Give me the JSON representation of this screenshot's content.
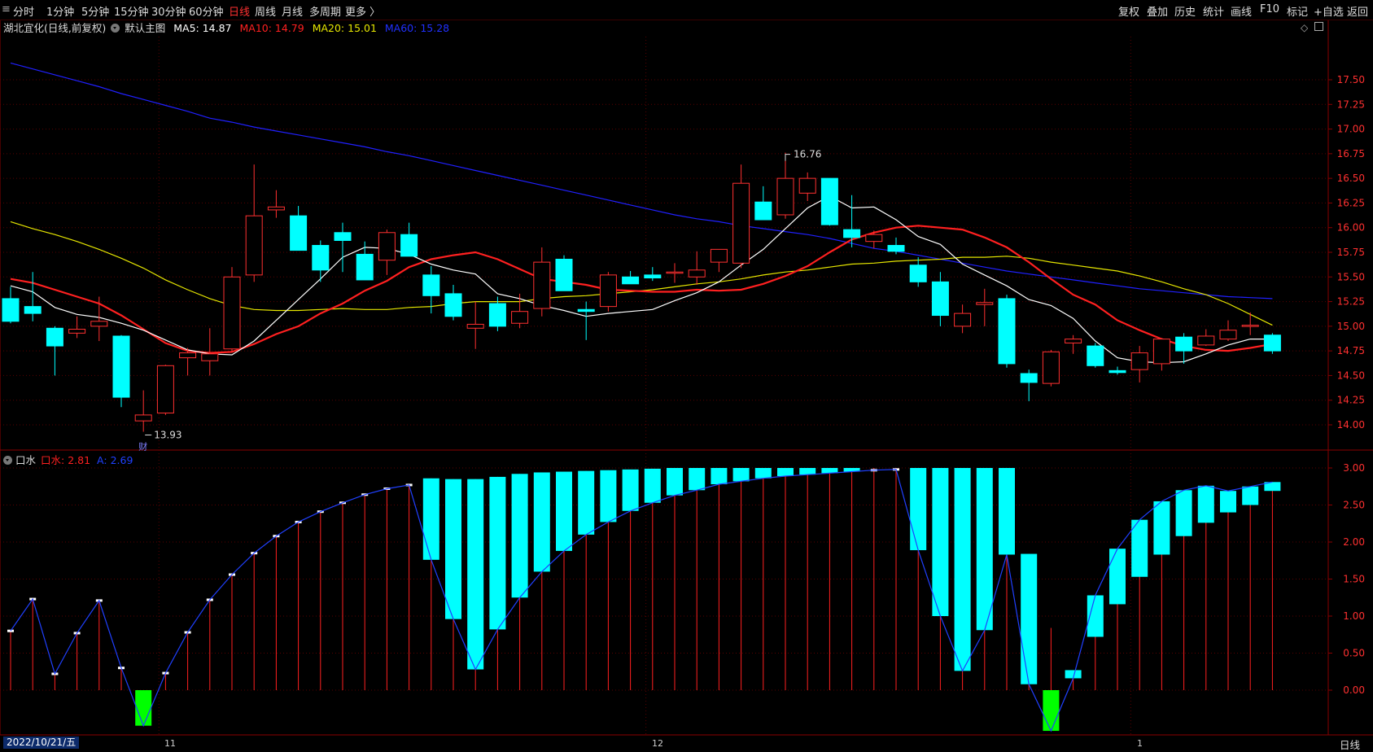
{
  "toolbar": {
    "menu_icon": "≡",
    "periods": [
      "分时",
      "1分钟",
      "5分钟",
      "15分钟",
      "30分钟",
      "60分钟",
      "日线",
      "周线",
      "月线",
      "多周期",
      "更多 〉"
    ],
    "active_period": "日线",
    "right_items": [
      "复权",
      "叠加",
      "历史",
      "统计",
      "画线",
      "F10",
      "标记",
      "+自选",
      "返回"
    ]
  },
  "info": {
    "stock": "湖北宜化(日线,前复权)",
    "main_chart": "默认主图",
    "ma5": "MA5: 14.87",
    "ma10": "MA10: 14.79",
    "ma20": "MA20: 15.01",
    "ma60": "MA60: 15.28",
    "high_label": "16.76",
    "low_label": "13.93",
    "cai_label": "财"
  },
  "indicator": {
    "name": "口水",
    "value1": "口水: 2.81",
    "value2": "A: 2.69"
  },
  "bottom": {
    "date": "2022/10/21/五",
    "period": "日线",
    "months": [
      "11",
      "12",
      "1"
    ]
  },
  "colors": {
    "up": "#ff3030",
    "down": "#00ffff",
    "ma5": "#ffffff",
    "ma10": "#ff2020",
    "ma20": "#e6e600",
    "ma60": "#2020ff",
    "grid": "#5a0000",
    "indicator_line": "#2040ff",
    "neg_bar": "#00ff00"
  },
  "chart_data": [
    {
      "type": "candlestick",
      "title": "湖北宜化(日线,前复权)",
      "ylim": [
        13.8,
        17.8
      ],
      "y_ticks": [
        14.0,
        14.25,
        14.5,
        14.75,
        15.0,
        15.25,
        15.5,
        15.75,
        16.0,
        16.25,
        16.5,
        16.75,
        17.0,
        17.25,
        17.5
      ],
      "candles": [
        {
          "o": 15.28,
          "h": 15.4,
          "l": 15.03,
          "c": 15.05
        },
        {
          "o": 15.2,
          "h": 15.55,
          "l": 15.05,
          "c": 15.13
        },
        {
          "o": 14.98,
          "h": 15.0,
          "l": 14.5,
          "c": 14.8
        },
        {
          "o": 14.93,
          "h": 15.1,
          "l": 14.88,
          "c": 14.97
        },
        {
          "o": 15.0,
          "h": 15.3,
          "l": 14.85,
          "c": 15.05
        },
        {
          "o": 14.9,
          "h": 14.91,
          "l": 14.18,
          "c": 14.28
        },
        {
          "o": 14.04,
          "h": 14.35,
          "l": 13.93,
          "c": 14.1
        },
        {
          "o": 14.12,
          "h": 14.61,
          "l": 14.1,
          "c": 14.6
        },
        {
          "o": 14.68,
          "h": 14.78,
          "l": 14.5,
          "c": 14.73
        },
        {
          "o": 14.65,
          "h": 14.98,
          "l": 14.5,
          "c": 14.72
        },
        {
          "o": 14.77,
          "h": 15.6,
          "l": 14.74,
          "c": 15.5
        },
        {
          "o": 15.52,
          "h": 16.64,
          "l": 15.45,
          "c": 16.12
        },
        {
          "o": 16.18,
          "h": 16.38,
          "l": 16.1,
          "c": 16.21
        },
        {
          "o": 16.12,
          "h": 16.22,
          "l": 15.78,
          "c": 15.77
        },
        {
          "o": 15.82,
          "h": 15.87,
          "l": 15.45,
          "c": 15.57
        },
        {
          "o": 15.95,
          "h": 16.05,
          "l": 15.55,
          "c": 15.87
        },
        {
          "o": 15.73,
          "h": 15.86,
          "l": 15.47,
          "c": 15.47
        },
        {
          "o": 15.67,
          "h": 15.98,
          "l": 15.52,
          "c": 15.95
        },
        {
          "o": 15.93,
          "h": 16.05,
          "l": 15.73,
          "c": 15.71
        },
        {
          "o": 15.52,
          "h": 15.61,
          "l": 15.13,
          "c": 15.31
        },
        {
          "o": 15.33,
          "h": 15.42,
          "l": 15.06,
          "c": 15.1
        },
        {
          "o": 14.98,
          "h": 15.25,
          "l": 14.77,
          "c": 15.02
        },
        {
          "o": 15.23,
          "h": 15.3,
          "l": 14.95,
          "c": 15.0
        },
        {
          "o": 15.03,
          "h": 15.33,
          "l": 14.98,
          "c": 15.15
        },
        {
          "o": 15.18,
          "h": 15.8,
          "l": 15.1,
          "c": 15.65
        },
        {
          "o": 15.68,
          "h": 15.72,
          "l": 15.4,
          "c": 15.36
        },
        {
          "o": 15.17,
          "h": 15.25,
          "l": 14.86,
          "c": 15.15
        },
        {
          "o": 15.2,
          "h": 15.55,
          "l": 15.15,
          "c": 15.52
        },
        {
          "o": 15.5,
          "h": 15.56,
          "l": 15.44,
          "c": 15.43
        },
        {
          "o": 15.52,
          "h": 15.6,
          "l": 15.46,
          "c": 15.49
        },
        {
          "o": 15.55,
          "h": 15.64,
          "l": 15.44,
          "c": 15.55
        },
        {
          "o": 15.5,
          "h": 15.76,
          "l": 15.42,
          "c": 15.57
        },
        {
          "o": 15.65,
          "h": 15.78,
          "l": 15.55,
          "c": 15.78
        },
        {
          "o": 15.64,
          "h": 16.64,
          "l": 15.59,
          "c": 16.45
        },
        {
          "o": 16.26,
          "h": 16.42,
          "l": 16.1,
          "c": 16.08
        },
        {
          "o": 16.13,
          "h": 16.76,
          "l": 16.09,
          "c": 16.5
        },
        {
          "o": 16.35,
          "h": 16.56,
          "l": 16.27,
          "c": 16.5
        },
        {
          "o": 16.5,
          "h": 16.5,
          "l": 16.02,
          "c": 16.03
        },
        {
          "o": 15.98,
          "h": 16.33,
          "l": 15.8,
          "c": 15.9
        },
        {
          "o": 15.86,
          "h": 15.97,
          "l": 15.79,
          "c": 15.93
        },
        {
          "o": 15.82,
          "h": 15.9,
          "l": 15.73,
          "c": 15.76
        },
        {
          "o": 15.62,
          "h": 15.7,
          "l": 15.4,
          "c": 15.45
        },
        {
          "o": 15.45,
          "h": 15.55,
          "l": 15.0,
          "c": 15.11
        },
        {
          "o": 15.0,
          "h": 15.22,
          "l": 14.93,
          "c": 15.13
        },
        {
          "o": 15.22,
          "h": 15.38,
          "l": 15.0,
          "c": 15.24
        },
        {
          "o": 15.28,
          "h": 15.32,
          "l": 14.58,
          "c": 14.62
        },
        {
          "o": 14.52,
          "h": 14.56,
          "l": 14.24,
          "c": 14.43
        },
        {
          "o": 14.42,
          "h": 14.76,
          "l": 14.39,
          "c": 14.74
        },
        {
          "o": 14.83,
          "h": 14.91,
          "l": 14.72,
          "c": 14.87
        },
        {
          "o": 14.8,
          "h": 14.83,
          "l": 14.58,
          "c": 14.6
        },
        {
          "o": 14.55,
          "h": 14.59,
          "l": 14.51,
          "c": 14.53
        },
        {
          "o": 14.56,
          "h": 14.8,
          "l": 14.43,
          "c": 14.73
        },
        {
          "o": 14.62,
          "h": 14.88,
          "l": 14.55,
          "c": 14.87
        },
        {
          "o": 14.89,
          "h": 14.93,
          "l": 14.62,
          "c": 14.75
        },
        {
          "o": 14.81,
          "h": 14.97,
          "l": 14.8,
          "c": 14.9
        },
        {
          "o": 14.87,
          "h": 15.06,
          "l": 14.85,
          "c": 14.96
        },
        {
          "o": 15.0,
          "h": 15.14,
          "l": 14.91,
          "c": 15.01
        },
        {
          "o": 14.91,
          "h": 14.93,
          "l": 14.72,
          "c": 14.75
        }
      ],
      "ma5": [
        15.41,
        15.35,
        15.19,
        15.12,
        15.09,
        15.03,
        14.96,
        14.86,
        14.76,
        14.72,
        14.71,
        14.85,
        15.06,
        15.27,
        15.48,
        15.7,
        15.8,
        15.79,
        15.73,
        15.63,
        15.57,
        15.53,
        15.33,
        15.28,
        15.21,
        15.16,
        15.1,
        15.13,
        15.15,
        15.17,
        15.26,
        15.34,
        15.45,
        15.62,
        15.78,
        15.99,
        16.2,
        16.32,
        16.2,
        16.21,
        16.08,
        15.91,
        15.83,
        15.63,
        15.52,
        15.41,
        15.27,
        15.21,
        15.08,
        14.85,
        14.68,
        14.64,
        14.63,
        14.64,
        14.72,
        14.81,
        14.87,
        14.87
      ],
      "ma10": [
        15.48,
        15.44,
        15.37,
        15.3,
        15.23,
        15.11,
        14.97,
        14.83,
        14.75,
        14.73,
        14.74,
        14.82,
        14.92,
        15.0,
        15.13,
        15.23,
        15.36,
        15.46,
        15.6,
        15.68,
        15.72,
        15.75,
        15.68,
        15.58,
        15.48,
        15.45,
        15.42,
        15.37,
        15.36,
        15.35,
        15.35,
        15.37,
        15.36,
        15.37,
        15.43,
        15.51,
        15.61,
        15.75,
        15.88,
        15.95,
        16.0,
        16.02,
        16.0,
        15.98,
        15.9,
        15.8,
        15.65,
        15.48,
        15.32,
        15.22,
        15.06,
        14.96,
        14.87,
        14.8,
        14.76,
        14.75,
        14.78,
        14.82
      ],
      "ma20": [
        16.06,
        15.99,
        15.93,
        15.86,
        15.78,
        15.69,
        15.59,
        15.47,
        15.37,
        15.28,
        15.21,
        15.17,
        15.16,
        15.16,
        15.17,
        15.18,
        15.17,
        15.17,
        15.19,
        15.2,
        15.23,
        15.25,
        15.25,
        15.25,
        15.28,
        15.3,
        15.31,
        15.33,
        15.35,
        15.37,
        15.4,
        15.43,
        15.45,
        15.48,
        15.52,
        15.55,
        15.57,
        15.6,
        15.63,
        15.64,
        15.66,
        15.67,
        15.68,
        15.7,
        15.7,
        15.71,
        15.69,
        15.65,
        15.62,
        15.59,
        15.56,
        15.51,
        15.45,
        15.38,
        15.32,
        15.23,
        15.12,
        15.01
      ],
      "ma60": [
        17.67,
        17.61,
        17.55,
        17.49,
        17.43,
        17.36,
        17.3,
        17.24,
        17.18,
        17.11,
        17.07,
        17.02,
        16.98,
        16.94,
        16.9,
        16.86,
        16.82,
        16.77,
        16.73,
        16.68,
        16.63,
        16.58,
        16.53,
        16.48,
        16.43,
        16.38,
        16.33,
        16.28,
        16.23,
        16.18,
        16.13,
        16.09,
        16.06,
        16.02,
        15.99,
        15.96,
        15.93,
        15.89,
        15.84,
        15.79,
        15.76,
        15.72,
        15.68,
        15.64,
        15.6,
        15.56,
        15.53,
        15.5,
        15.47,
        15.44,
        15.41,
        15.38,
        15.36,
        15.34,
        15.32,
        15.3,
        15.29,
        15.28
      ]
    },
    {
      "type": "bar",
      "title": "口水",
      "ylim": [
        -0.6,
        3.2
      ],
      "y_ticks": [
        0.0,
        0.5,
        1.0,
        1.5,
        2.0,
        2.5,
        3.0
      ],
      "kou": [
        0.8,
        1.23,
        0.22,
        0.77,
        1.21,
        0.3,
        -0.48,
        0.23,
        0.78,
        1.22,
        1.56,
        1.85,
        2.08,
        2.27,
        2.41,
        2.53,
        2.64,
        2.72,
        2.77,
        1.76,
        0.96,
        0.28,
        0.82,
        1.25,
        1.6,
        1.88,
        2.1,
        2.27,
        2.42,
        2.53,
        2.63,
        2.7,
        2.78,
        2.82,
        2.86,
        2.89,
        2.91,
        2.93,
        2.95,
        2.97,
        2.98,
        1.89,
        1.0,
        0.26,
        0.81,
        1.83,
        0.08,
        -0.55,
        0.16,
        1.28,
        1.91,
        2.3,
        2.55,
        2.7,
        2.76,
        2.69,
        2.75,
        2.81
      ],
      "a": [
        0.8,
        1.23,
        0.22,
        0.77,
        1.21,
        0.3,
        -0.48,
        0.23,
        0.78,
        1.22,
        1.56,
        1.85,
        2.08,
        2.27,
        2.41,
        2.53,
        2.64,
        2.72,
        2.77,
        2.86,
        2.85,
        2.85,
        2.88,
        2.92,
        2.94,
        2.95,
        2.96,
        2.97,
        2.98,
        2.99,
        3.0,
        3.0,
        3.0,
        3.0,
        3.0,
        3.0,
        3.0,
        3.0,
        3.0,
        3.0,
        3.0,
        3.0,
        3.0,
        3.0,
        3.0,
        3.0,
        1.84,
        0.84,
        0.27,
        0.72,
        1.16,
        1.53,
        1.83,
        2.08,
        2.26,
        2.4,
        2.5,
        2.69
      ],
      "series": [
        {
          "name": "口水"
        },
        {
          "name": "A"
        }
      ]
    }
  ]
}
